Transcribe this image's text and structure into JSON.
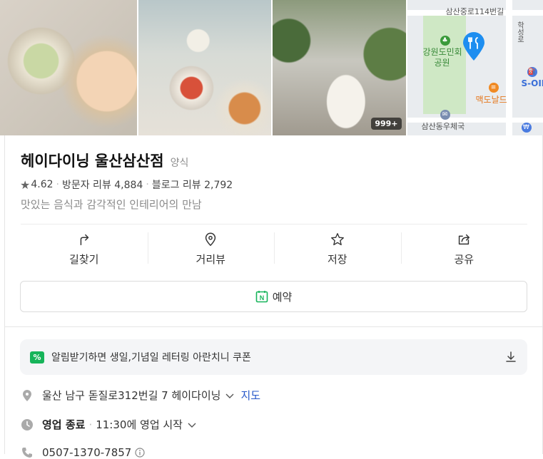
{
  "photos": {
    "more_count": "999+"
  },
  "map": {
    "road_label_1": "삼산중로114번길",
    "road_label_2": "학성로",
    "park_label_1": "강원도민회",
    "park_label_2": "공원",
    "mcdonalds_label": "맥도날드",
    "soil_label": "S-OIL",
    "post_office_label": "삼산동우체국"
  },
  "place": {
    "name": "헤이다이닝 울산삼산점",
    "category": "양식",
    "rating": "4.62",
    "visitor_reviews": "방문자 리뷰 4,884",
    "blog_reviews": "블로그 리뷰 2,792",
    "description": "맛있는 음식과 감각적인 인테리어의 만남"
  },
  "actions": [
    {
      "label": "길찾기",
      "icon": "directions-icon"
    },
    {
      "label": "거리뷰",
      "icon": "location-pin-icon"
    },
    {
      "label": "저장",
      "icon": "star-icon"
    },
    {
      "label": "공유",
      "icon": "share-icon"
    }
  ],
  "reserve": {
    "label": "예약",
    "icon_letter": "N"
  },
  "coupon": {
    "badge": "%",
    "text": "알림받기하면 생일,기념일 레터링 아란치니 쿠폰"
  },
  "address": {
    "text": "울산 남구 돋질로312번길 7 헤이다이닝",
    "map_link": "지도"
  },
  "hours": {
    "status": "영업 종료",
    "next": "11:30에 영업 시작"
  },
  "phone": {
    "number": "0507-1370-7857"
  },
  "colors": {
    "naver_green": "#17b45a",
    "link_blue": "#2657c9",
    "pin_blue": "#1e8ef0"
  }
}
